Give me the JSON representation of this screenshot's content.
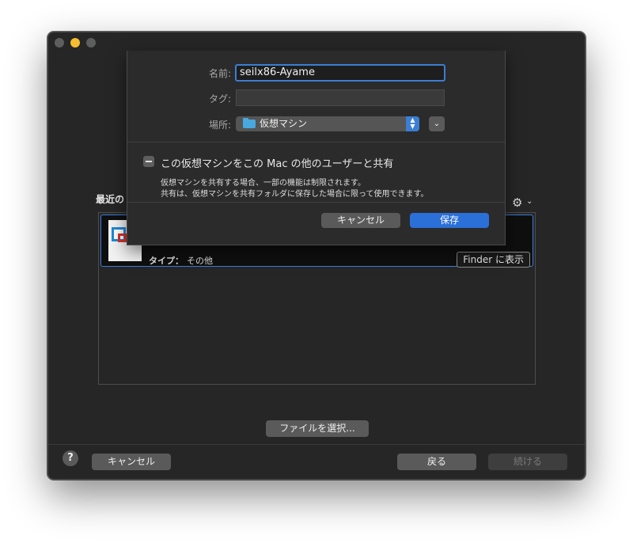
{
  "recent": {
    "title": "最近の",
    "item": {
      "type_label": "タイプ：",
      "type_value": "その他",
      "finder_button": "Finder に表示"
    }
  },
  "buttons": {
    "choose_file": "ファイルを選択...",
    "help": "?",
    "cancel": "キャンセル",
    "back": "戻る",
    "continue": "続ける"
  },
  "sheet": {
    "name_label": "名前:",
    "name_value": "seilx86-Ayame",
    "tags_label": "タグ:",
    "location_label": "場所:",
    "location_value": "仮想マシン",
    "share_label": "この仮想マシンをこの Mac の他のユーザーと共有",
    "share_desc_1": "仮想マシンを共有する場合、一部の機能は制限されます。",
    "share_desc_2": "共有は、仮想マシンを共有フォルダに保存した場合に限って使用できます。",
    "cancel": "キャンセル",
    "save": "保存"
  },
  "colors": {
    "accent": "#2b6fd8",
    "window_bg": "#262626",
    "sheet_bg": "#2b2b2b"
  }
}
